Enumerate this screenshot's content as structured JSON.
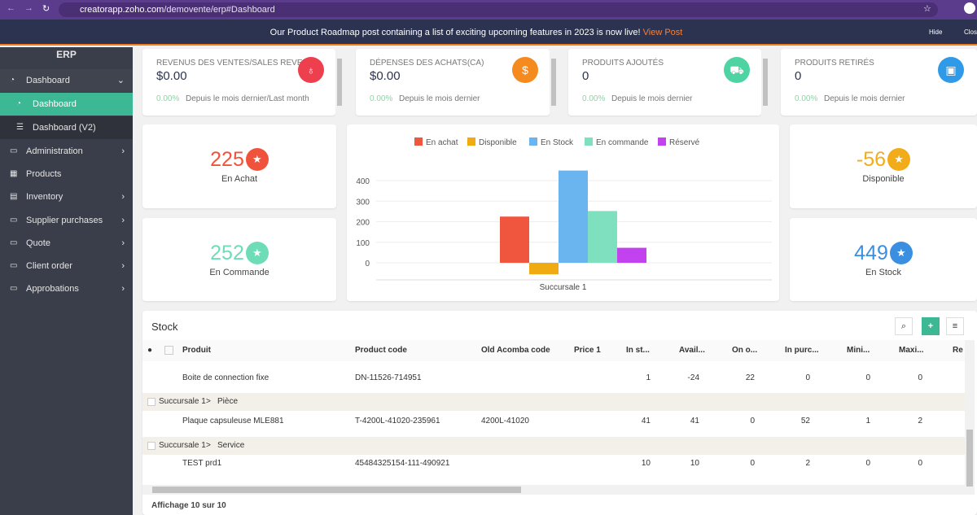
{
  "browser": {
    "url_domain": "creatorapp.zoho.com",
    "url_path": "/demovente/erp#Dashboard"
  },
  "banner": {
    "text": "Our Product Roadmap post containing a list of exciting upcoming features in 2023 is now live!",
    "link": "View Post",
    "hide": "Hide",
    "close": "Close"
  },
  "sidebar": {
    "title": "ERP",
    "items": [
      {
        "label": "Dashboard"
      },
      {
        "label": "Dashboard"
      },
      {
        "label": "Dashboard (V2)"
      },
      {
        "label": "Administration"
      },
      {
        "label": "Products"
      },
      {
        "label": "Inventory"
      },
      {
        "label": "Supplier purchases"
      },
      {
        "label": "Quote"
      },
      {
        "label": "Client order"
      },
      {
        "label": "Approbations"
      }
    ]
  },
  "kpis": [
    {
      "title": "REVENUS DES VENTES/SALES REVENUS",
      "value": "$0.00",
      "pct": "0.00%",
      "desc": "Depuis le mois dernier/Last month",
      "color": "#ee3f4f"
    },
    {
      "title": "DÉPENSES DES ACHATS(CA)",
      "value": "$0.00",
      "pct": "0.00%",
      "desc": "Depuis le mois dernier",
      "color": "#f58a1f"
    },
    {
      "title": "PRODUITS AJOUTÉS",
      "value": "0",
      "pct": "0.00%",
      "desc": "Depuis le mois dernier",
      "color": "#4ed3a3"
    },
    {
      "title": "PRODUITS RETIRÉS",
      "value": "0",
      "pct": "0.00%",
      "desc": "Depuis le mois dernier",
      "color": "#2f9ae8"
    }
  ],
  "stats": [
    {
      "value": "225",
      "label": "En Achat",
      "color": "#f0533c"
    },
    {
      "value": "252",
      "label": "En Commande",
      "color": "#6fdcb8"
    },
    {
      "value": "-56",
      "label": "Disponible",
      "color": "#f2ac1a"
    },
    {
      "value": "449",
      "label": "En Stock",
      "color": "#3a8fe0"
    }
  ],
  "chart_data": {
    "type": "bar",
    "categories": [
      "Succursale 1"
    ],
    "xlabel": "Succursale 1",
    "ylim": [
      -60,
      450
    ],
    "yticks": [
      0,
      100,
      200,
      300,
      400
    ],
    "legend": "top",
    "series": [
      {
        "name": "En achat",
        "values": [
          225
        ],
        "color": "#f0553e"
      },
      {
        "name": "Disponible",
        "values": [
          -56
        ],
        "color": "#f0aa12"
      },
      {
        "name": "En Stock",
        "values": [
          449
        ],
        "color": "#6ab4f0"
      },
      {
        "name": "En commande",
        "values": [
          252
        ],
        "color": "#7ee0be"
      },
      {
        "name": "Réservé",
        "values": [
          73
        ],
        "color": "#c342ef"
      }
    ]
  },
  "stock": {
    "title": "Stock",
    "footer": "Affichage 10 sur 10",
    "columns": [
      "Produit",
      "Product code",
      "Old Acomba code",
      "Price 1",
      "In st...",
      "Avail...",
      "On o...",
      "In purc...",
      "Mini...",
      "Maxi...",
      "Re"
    ],
    "rows": [
      {
        "type": "item",
        "cells": [
          "Boite de connection fixe",
          "DN-11526-714951",
          "",
          "",
          "1",
          "-24",
          "22",
          "0",
          "0",
          "0"
        ]
      },
      {
        "type": "group",
        "branch": "Succursale 1",
        "sep": ">",
        "cat": "Pièce"
      },
      {
        "type": "item",
        "cells": [
          "Plaque capsuleuse MLE881",
          "T-4200L-41020-235961",
          "4200L-41020",
          "",
          "41",
          "41",
          "0",
          "52",
          "1",
          "2"
        ]
      },
      {
        "type": "group",
        "branch": "Succursale 1",
        "sep": ">",
        "cat": "Service"
      },
      {
        "type": "item",
        "cells": [
          "TEST prd1",
          "45484325154-111-490921",
          "",
          "",
          "10",
          "10",
          "0",
          "2",
          "0",
          "0"
        ]
      }
    ]
  }
}
